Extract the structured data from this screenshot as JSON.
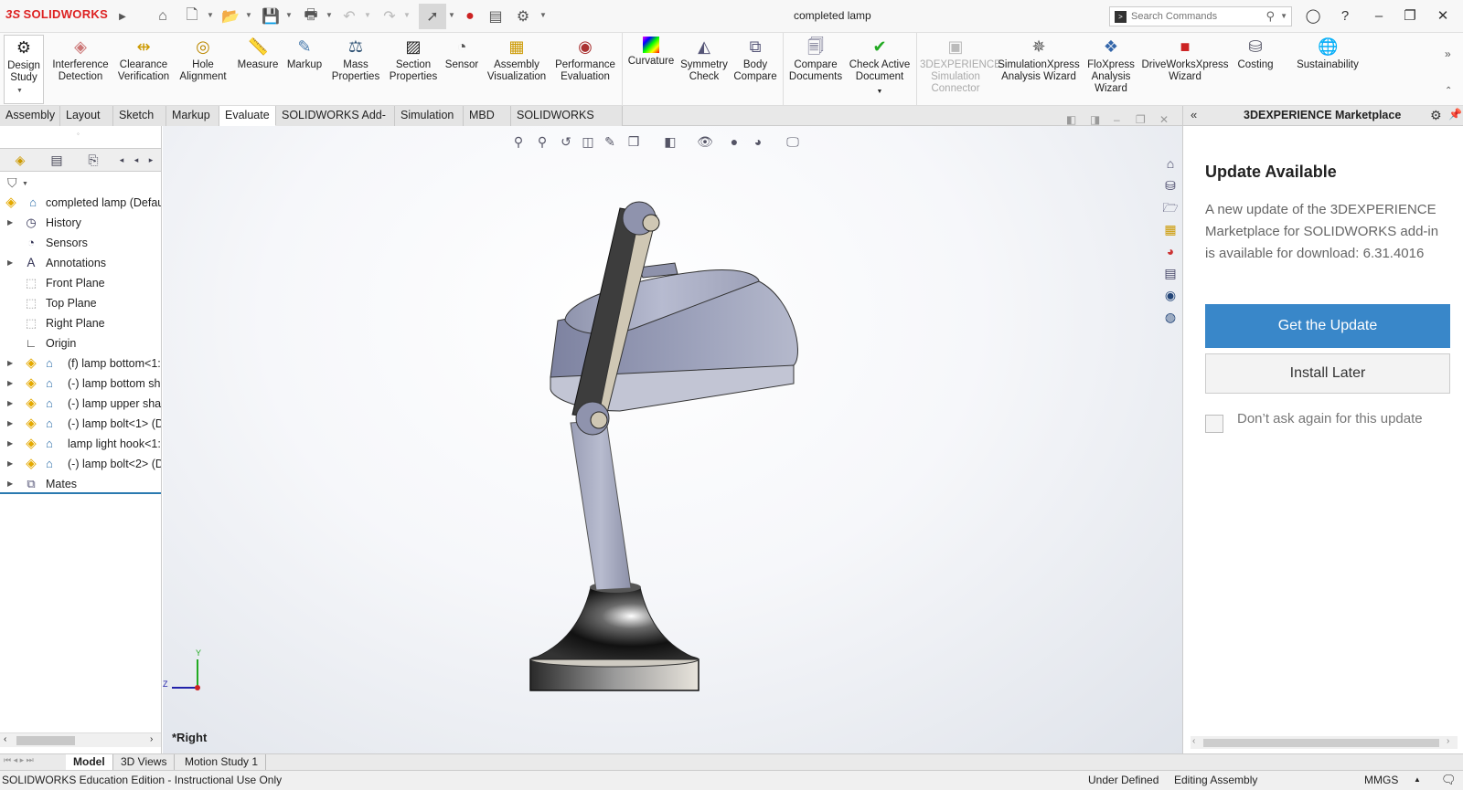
{
  "app": {
    "brand": "SOLIDWORKS",
    "document_title": "completed lamp"
  },
  "search": {
    "placeholder": "Search Commands"
  },
  "ribbon": [
    {
      "id": "design-study",
      "label": "Design Study"
    },
    {
      "id": "interference-detection",
      "label": "Interference Detection"
    },
    {
      "id": "clearance-verification",
      "label": "Clearance Verification"
    },
    {
      "id": "hole-alignment",
      "label": "Hole Alignment"
    },
    {
      "id": "measure",
      "label": "Measure"
    },
    {
      "id": "markup",
      "label": "Markup"
    },
    {
      "id": "mass-properties",
      "label": "Mass Properties"
    },
    {
      "id": "section-properties",
      "label": "Section Properties"
    },
    {
      "id": "sensor",
      "label": "Sensor"
    },
    {
      "id": "assembly-visualization",
      "label": "Assembly Visualization"
    },
    {
      "id": "performance-evaluation",
      "label": "Performance Evaluation"
    },
    {
      "id": "curvature",
      "label": "Curvature"
    },
    {
      "id": "symmetry-check",
      "label": "Symmetry Check"
    },
    {
      "id": "body-compare",
      "label": "Body Compare"
    },
    {
      "id": "compare-documents",
      "label": "Compare Documents"
    },
    {
      "id": "check-active-document",
      "label": "Check Active Document"
    },
    {
      "id": "3dx-sim-connector",
      "label": "3DEXPERIENCE Simulation Connector"
    },
    {
      "id": "simulationxpress",
      "label": "SimulationXpress Analysis Wizard"
    },
    {
      "id": "floxpress",
      "label": "FloXpress Analysis Wizard"
    },
    {
      "id": "driveworksxpress",
      "label": "DriveWorksXpress Wizard"
    },
    {
      "id": "costing",
      "label": "Costing"
    },
    {
      "id": "sustainability",
      "label": "Sustainability"
    }
  ],
  "tabs": [
    "Assembly",
    "Layout",
    "Sketch",
    "Markup",
    "Evaluate",
    "SOLIDWORKS Add-Ins",
    "Simulation",
    "MBD",
    "SOLIDWORKS CAM"
  ],
  "tree": {
    "root": "completed lamp (Defau",
    "items": [
      {
        "label": "History"
      },
      {
        "label": "Sensors"
      },
      {
        "label": "Annotations"
      },
      {
        "label": "Front Plane"
      },
      {
        "label": "Top Plane"
      },
      {
        "label": "Right Plane"
      },
      {
        "label": "Origin"
      },
      {
        "label": "(f) lamp bottom<1:"
      },
      {
        "label": "(-) lamp bottom sh"
      },
      {
        "label": "(-) lamp upper shaf"
      },
      {
        "label": "(-) lamp bolt<1> (D"
      },
      {
        "label": "lamp light hook<1:"
      },
      {
        "label": "(-) lamp bolt<2> (D"
      },
      {
        "label": "Mates"
      }
    ]
  },
  "viewport": {
    "view_name": "*Right",
    "triad_y": "Y",
    "triad_z": "Z"
  },
  "marketplace": {
    "title": "3DEXPERIENCE Marketplace",
    "heading": "Update Available",
    "body": "A new update of the 3DEXPERIENCE Marketplace for SOLIDWORKS add-in is available for download: 6.31.4016",
    "primary_button": "Get the Update",
    "secondary_button": "Install Later",
    "checkbox_label": "Don’t ask again for this update",
    "accent": "#3987c9"
  },
  "bottom_tabs": [
    "Model",
    "3D Views",
    "Motion Study 1"
  ],
  "status": {
    "left": "SOLIDWORKS Education Edition - Instructional Use Only",
    "state": "Under Defined",
    "mode": "Editing Assembly",
    "units": "MMGS"
  }
}
